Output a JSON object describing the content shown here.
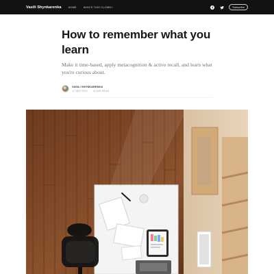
{
  "header": {
    "brand": "Vasili Shynkarenka",
    "nav": [
      "HOME",
      "WHO'S THIS CLOWN?"
    ],
    "subscribe_label": "Subscribe",
    "icons": [
      "facebook-icon",
      "twitter-icon"
    ]
  },
  "article": {
    "title": "How to remember what you learn",
    "subtitle": "Make it time-based, apply metacognition & active recall, and learn what you're curious about.",
    "author": "VASILI SHYNKARENKA",
    "date": "12 SEP 2022",
    "reading_time": "14 MIN READ"
  },
  "colors": {
    "topbar": "#111214",
    "title": "#15171a",
    "subtitle": "#6b737b"
  }
}
